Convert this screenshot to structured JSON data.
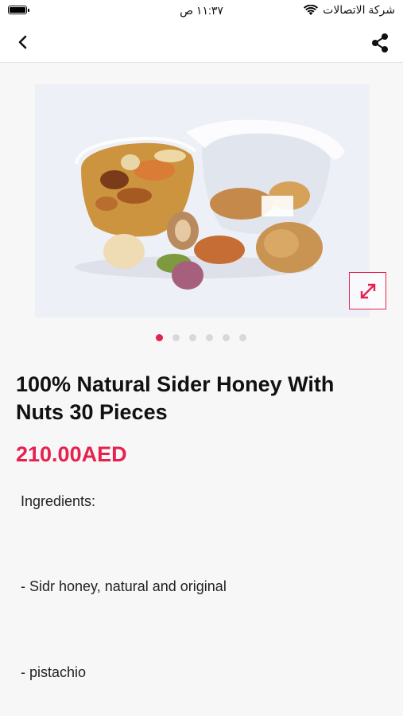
{
  "status_bar": {
    "time": "١١:٣٧ ص",
    "carrier": "شركة الاتصالات",
    "battery_level": 1.0
  },
  "nav": {
    "back_icon": "chevron-left-icon",
    "share_icon": "share-icon"
  },
  "gallery": {
    "image_count": 6,
    "active_index": 0,
    "image_alt": "Sidr honey with mixed nuts cups",
    "expand_icon": "expand-arrows-icon"
  },
  "product": {
    "title": "100% Natural Sider Honey With Nuts 30 Pieces",
    "price": "210.00AED",
    "accent_color": "#e6214f"
  },
  "description": {
    "lines": [
      "Ingredients:",
      "- Sidr honey, natural and original",
      "- pistachio"
    ]
  }
}
